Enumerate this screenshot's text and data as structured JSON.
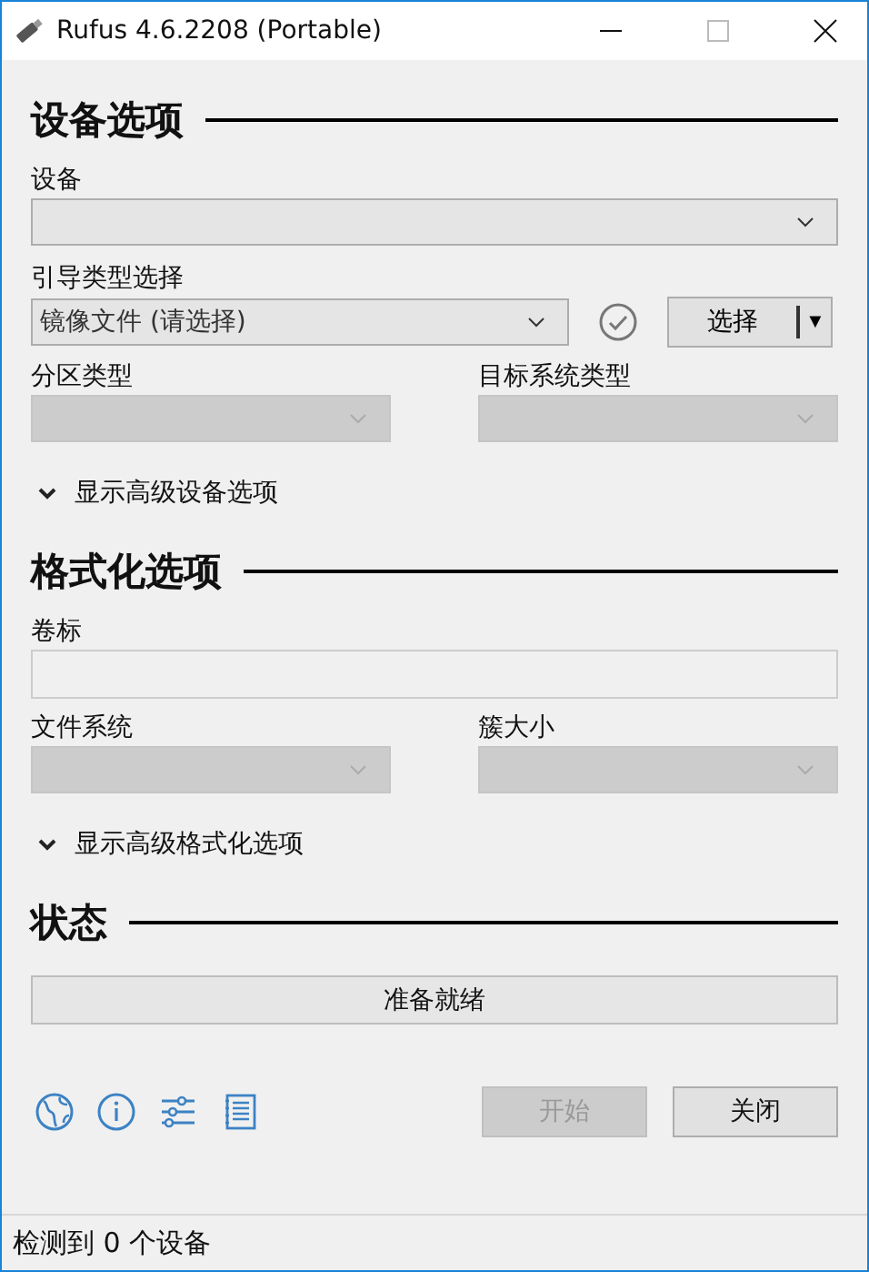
{
  "window": {
    "title": "Rufus 4.6.2208 (Portable)"
  },
  "device_section": {
    "heading": "设备选项",
    "device": {
      "label": "设备",
      "disabled": false
    },
    "boot": {
      "label": "引导类型选择",
      "value": "镜像文件 (请选择)",
      "select_button": "选择",
      "select_arrow": "▼"
    },
    "partition": {
      "label": "分区类型",
      "disabled": true
    },
    "target": {
      "label": "目标系统类型",
      "disabled": true
    },
    "advanced_toggle": "显示高级设备选项"
  },
  "format_section": {
    "heading": "格式化选项",
    "volume": {
      "label": "卷标",
      "disabled": true
    },
    "filesystem": {
      "label": "文件系统",
      "disabled": true
    },
    "cluster": {
      "label": "簇大小",
      "disabled": true
    },
    "advanced_toggle": "显示高级格式化选项"
  },
  "status_section": {
    "heading": "状态",
    "progress": "准备就绪"
  },
  "buttons": [
    {
      "label": "开始",
      "disabled": true
    },
    {
      "label": "关闭",
      "disabled": false
    }
  ],
  "status_bar": "检测到 0 个设备"
}
